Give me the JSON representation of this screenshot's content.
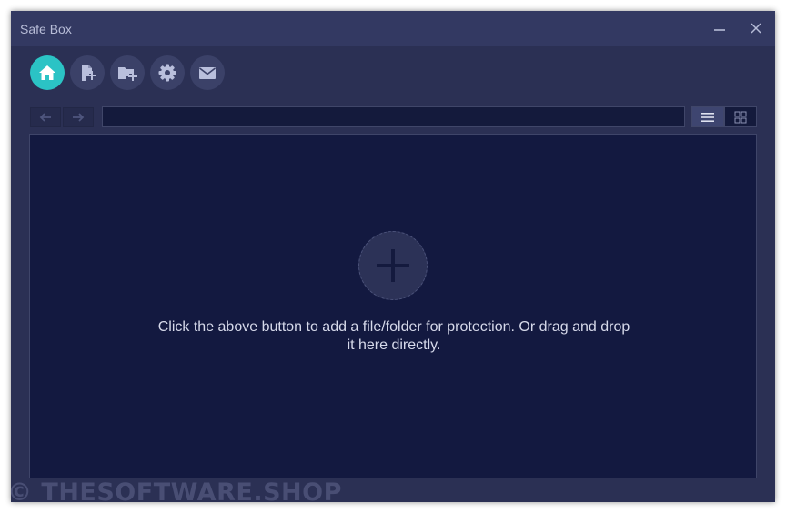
{
  "window": {
    "title": "Safe Box",
    "minimize_icon": "minimize-icon",
    "close_icon": "close-icon"
  },
  "toolbar": {
    "buttons": [
      {
        "icon": "home-icon",
        "active": true
      },
      {
        "icon": "add-file-icon",
        "active": false
      },
      {
        "icon": "add-folder-icon",
        "active": false
      },
      {
        "icon": "gear-icon",
        "active": false
      },
      {
        "icon": "mail-icon",
        "active": false
      }
    ]
  },
  "navigation": {
    "back_icon": "arrow-left-icon",
    "forward_icon": "arrow-right-icon",
    "path_value": "",
    "view_modes": [
      {
        "icon": "list-view-icon",
        "active": true
      },
      {
        "icon": "grid-view-icon",
        "active": false
      }
    ]
  },
  "content": {
    "add_icon": "plus-icon",
    "hint": "Click the above button to add a file/folder for protection. Or drag and drop it here directly."
  },
  "watermark": "© THESOFTWARE.SHOP",
  "colors": {
    "accent": "#2bc3c5",
    "window_bg": "#2b3054",
    "titlebar_bg": "#333962",
    "content_bg": "#131940"
  }
}
